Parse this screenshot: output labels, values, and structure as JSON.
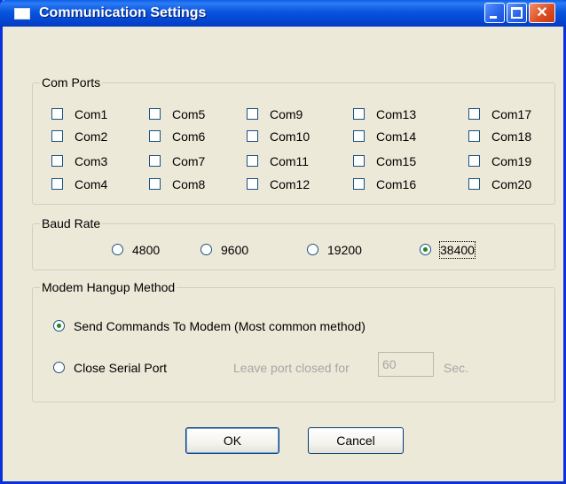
{
  "window": {
    "title": "Communication Settings",
    "close_glyph": "✕"
  },
  "com_ports": {
    "title": "Com Ports",
    "ports": [
      "Com1",
      "Com2",
      "Com3",
      "Com4",
      "Com5",
      "Com6",
      "Com7",
      "Com8",
      "Com9",
      "Com10",
      "Com11",
      "Com12",
      "Com13",
      "Com14",
      "Com15",
      "Com16",
      "Com17",
      "Com18",
      "Com19",
      "Com20"
    ],
    "checked": []
  },
  "baud_rate": {
    "title": "Baud Rate",
    "options": [
      "4800",
      "9600",
      "19200",
      "38400"
    ],
    "selected": "38400"
  },
  "modem_hangup": {
    "title": "Modem Hangup Method",
    "send_commands_label": "Send Commands To Modem  (Most common method)",
    "close_port_label": "Close Serial Port",
    "selected": "send_commands",
    "leave_closed_label": "Leave port closed for",
    "seconds_value": "60",
    "seconds_unit": "Sec."
  },
  "buttons": {
    "ok": "OK",
    "cancel": "Cancel"
  },
  "colors": {
    "titlebar": "#0855dd",
    "face": "#ece9d8",
    "radio_dot": "#1f8a24"
  }
}
